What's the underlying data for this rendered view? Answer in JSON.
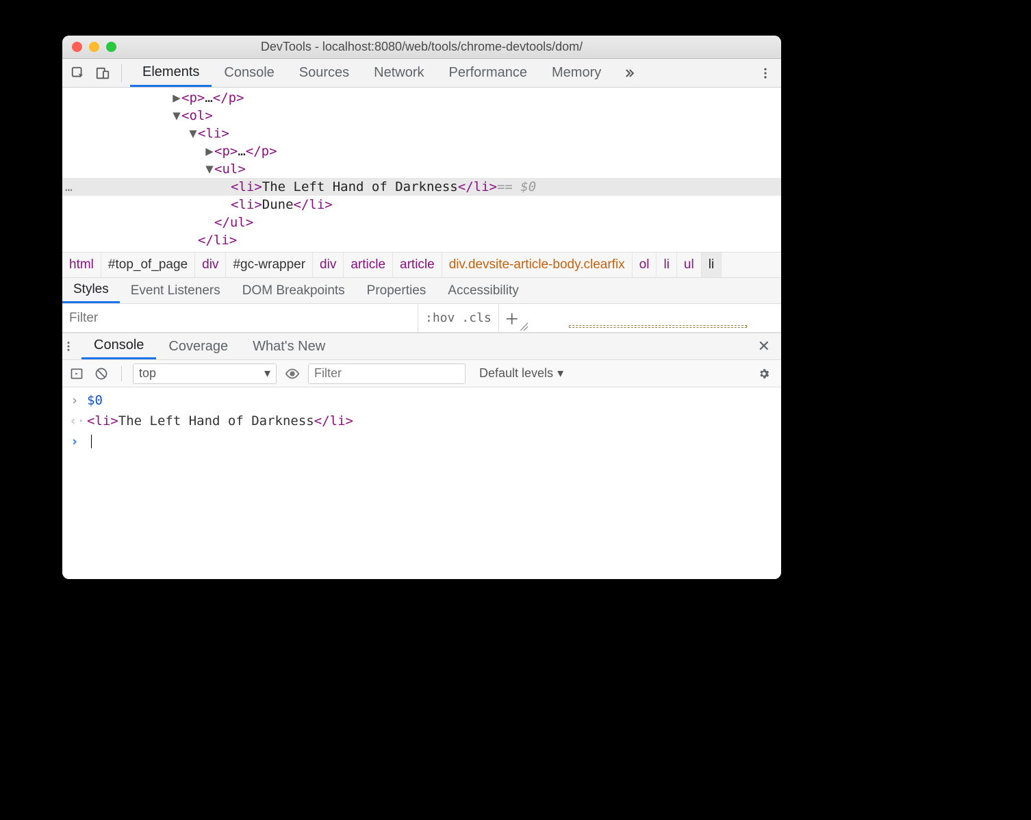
{
  "window": {
    "title": "DevTools - localhost:8080/web/tools/chrome-devtools/dom/"
  },
  "mainTabs": [
    "Elements",
    "Console",
    "Sources",
    "Network",
    "Performance",
    "Memory"
  ],
  "activeMainTab": "Elements",
  "tree": {
    "l1": {
      "open": "<p>",
      "mid": "…",
      "close": "</p>"
    },
    "l2": {
      "open": "<ol>"
    },
    "l3": {
      "open": "<li>"
    },
    "l4": {
      "open": "<p>",
      "mid": "…",
      "close": "</p>"
    },
    "l5": {
      "open": "<ul>"
    },
    "l6": {
      "open": "<li>",
      "text": "The Left Hand of Darkness",
      "close": "</li>",
      "suffix": " == $0"
    },
    "l7": {
      "open": "<li>",
      "text": "Dune",
      "close": "</li>"
    },
    "l8": {
      "close": "</ul>"
    },
    "l9": {
      "close": "</li>"
    }
  },
  "breadcrumbs": [
    "html",
    "#top_of_page",
    "div",
    "#gc-wrapper",
    "div",
    "article",
    "article",
    "div.devsite-article-body.clearfix",
    "ol",
    "li",
    "ul",
    "li"
  ],
  "subTabs": [
    "Styles",
    "Event Listeners",
    "DOM Breakpoints",
    "Properties",
    "Accessibility"
  ],
  "activeSubTab": "Styles",
  "stylesFilter": {
    "placeholder": "Filter",
    "hov": ":hov",
    "cls": ".cls"
  },
  "drawerTabs": [
    "Console",
    "Coverage",
    "What's New"
  ],
  "activeDrawerTab": "Console",
  "consoleToolbar": {
    "context": "top",
    "filterPlaceholder": "Filter",
    "levels": "Default levels"
  },
  "consoleLines": {
    "input1": "$0",
    "return1": {
      "open": "<li>",
      "text": "The Left Hand of Darkness",
      "close": "</li>"
    }
  }
}
